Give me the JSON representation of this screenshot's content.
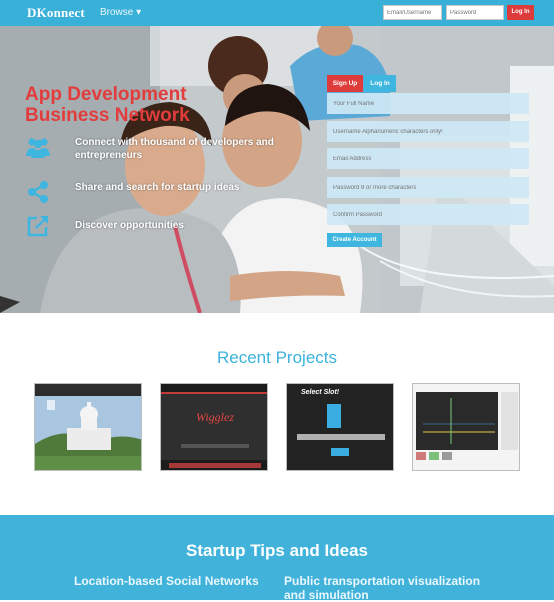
{
  "nav": {
    "logo": "DKonnect",
    "browse_label": "Browse",
    "email_placeholder": "Email/Username",
    "password_placeholder": "Password",
    "login_label": "Log In"
  },
  "hero": {
    "title": "App Development Business Network",
    "features": [
      {
        "icon": "users-icon",
        "text": "Connect with thousand of developers and entrepreneurs"
      },
      {
        "icon": "share-icon",
        "text": "Share and search for startup ideas"
      },
      {
        "icon": "external-link-icon",
        "text": "Discover opportunities"
      }
    ]
  },
  "signup": {
    "tab_signup": "Sign Up",
    "tab_login": "Log In",
    "full_name_placeholder": "Your Full Name",
    "username_placeholder": "Username Alphanumeric characters only!",
    "email_placeholder": "Email Address",
    "password_placeholder": "Password 8 or more characters",
    "confirm_placeholder": "Confirm Password",
    "create_label": "Create Account"
  },
  "recent_projects": {
    "title": "Recent Projects",
    "thumb2_label": "Wigglez",
    "thumb3_label": "Select Slot!"
  },
  "tips": {
    "title": "Startup Tips and Ideas",
    "items": [
      "Location-based Social Networks",
      "Public transportation visualization and simulation"
    ]
  },
  "colors": {
    "brand_blue": "#39b0d8",
    "accent_red": "#de3b3b",
    "light_blue_field": "#cde8f5"
  }
}
